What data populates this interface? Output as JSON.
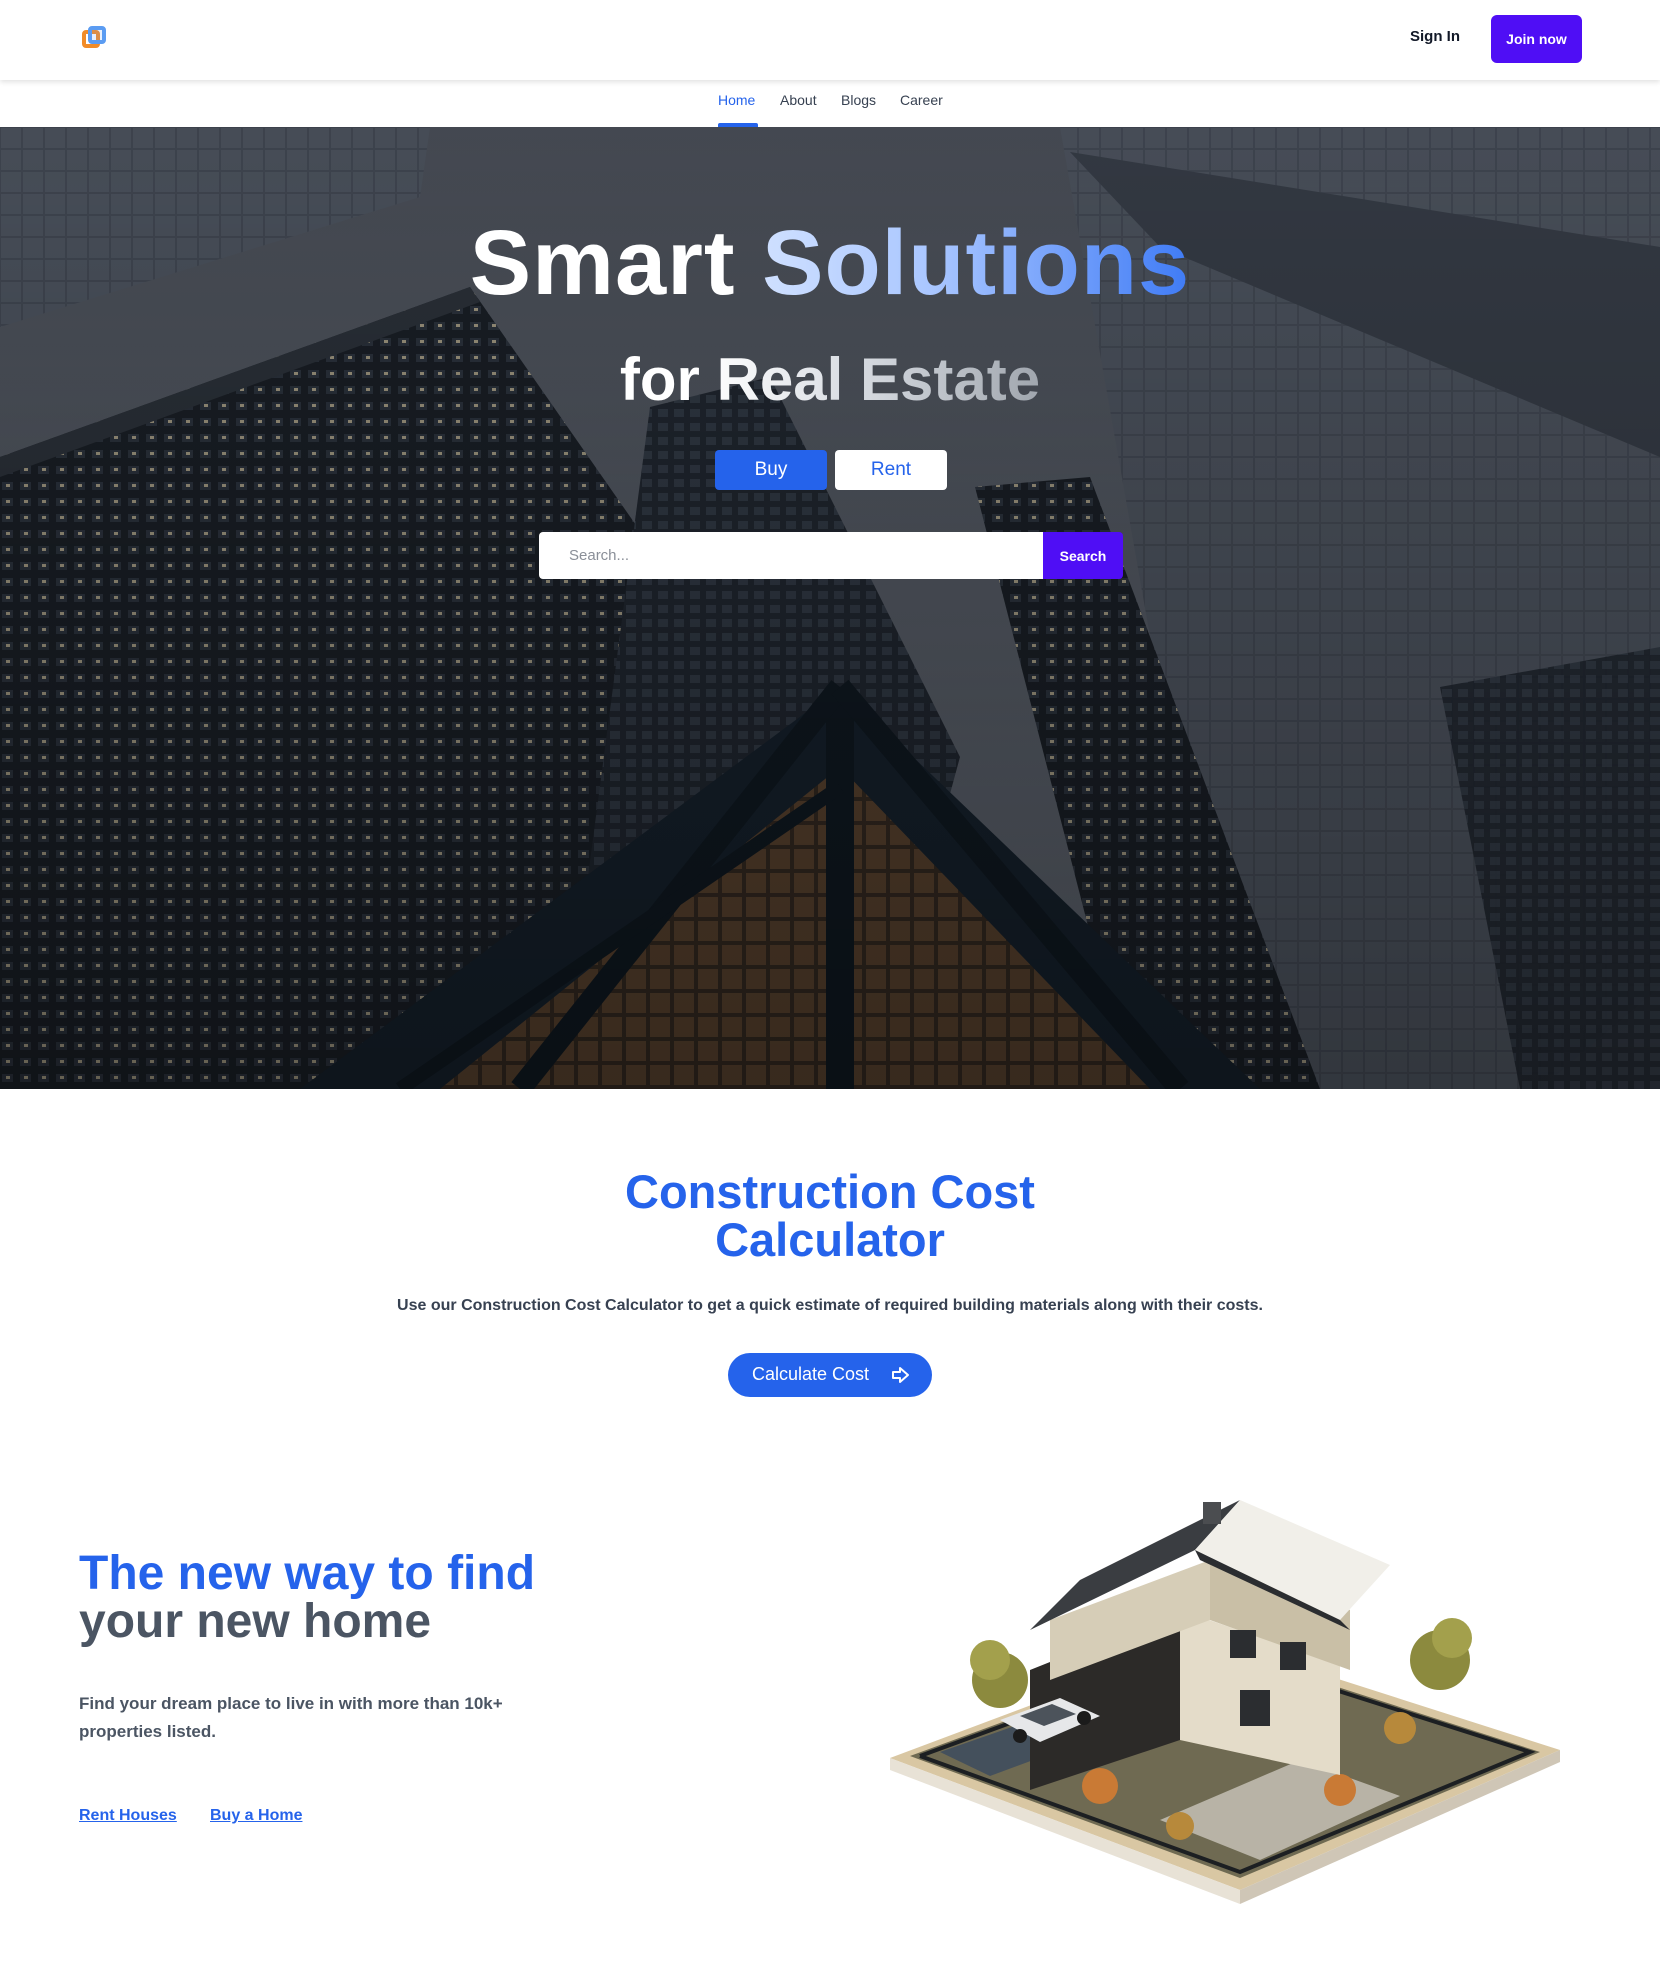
{
  "header": {
    "logo_name": "logo-icon",
    "sign_in_label": "Sign In",
    "join_label": "Join now"
  },
  "nav": {
    "tabs": [
      {
        "label": "Home",
        "active": true
      },
      {
        "label": "About",
        "active": false
      },
      {
        "label": "Blogs",
        "active": false
      },
      {
        "label": "Career",
        "active": false
      }
    ]
  },
  "hero": {
    "title_plain": "Smart",
    "title_accent": "Solutions",
    "subtitle": "for Real Estate",
    "buy_label": "Buy",
    "rent_label": "Rent",
    "search_placeholder": "Search...",
    "search_button": "Search"
  },
  "calculator": {
    "title_line1": "Construction Cost",
    "title_line2": "Calculator",
    "description": "Use our Construction Cost Calculator to get a quick estimate of required building materials along with their costs.",
    "button_label": "Calculate Cost",
    "button_icon": "arrow-right-icon"
  },
  "find": {
    "title_line1": "The new way to find",
    "title_line2": "your new home",
    "description": "Find your dream place to live in with more than 10k+ properties listed.",
    "links": [
      "Rent Houses",
      "Buy a Home"
    ]
  },
  "colors": {
    "primary": "#2563eb",
    "join_purple": "#4f0ef5",
    "logo_orange": "#f28c28",
    "logo_blue": "#5b9cf2"
  }
}
